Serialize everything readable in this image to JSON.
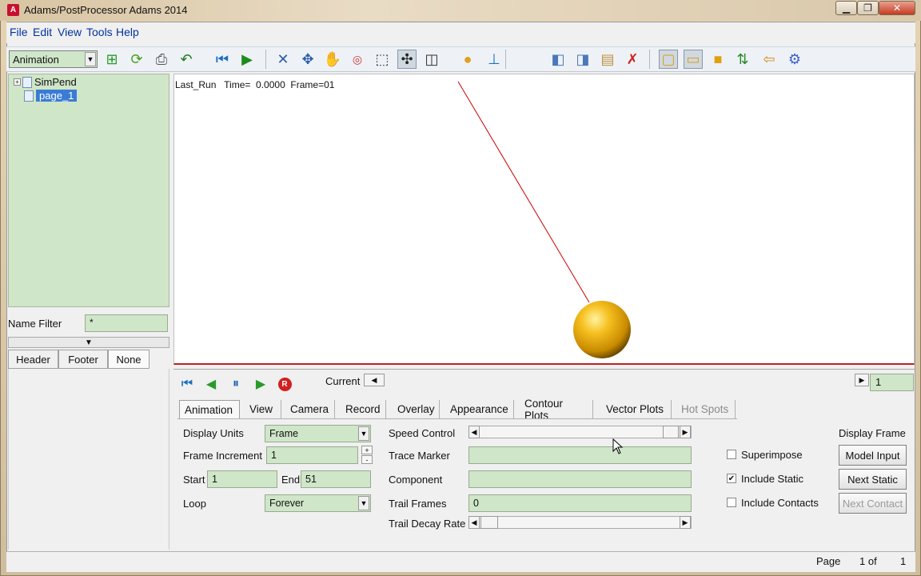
{
  "window": {
    "title": "Adams/PostProcessor Adams 2014",
    "logo_letter": "A"
  },
  "menu": [
    "File",
    "Edit",
    "View",
    "Tools",
    "Help"
  ],
  "toolbar": {
    "mode_select": "Animation",
    "icons": [
      "add-page-icon",
      "refresh-icon",
      "print-icon",
      "undo-icon",
      "rewind-icon",
      "play-icon",
      "select-icon",
      "translate-icon",
      "pan-hand-icon",
      "rotate-point-icon",
      "zoom-box-icon",
      "fit-icon",
      "wireframe-icon",
      "render-sphere-icon",
      "triad-icon",
      "prev-page-icon",
      "next-page-icon",
      "new-page-icon",
      "delete-page-icon",
      "layout-1-icon",
      "layout-2-icon",
      "layout-3-icon",
      "layout-4-icon",
      "layout-5-icon",
      "settings-gear-icon"
    ]
  },
  "tree": {
    "items": [
      {
        "label": "SimPend"
      },
      {
        "label": "page_1"
      }
    ]
  },
  "name_filter": {
    "label": "Name Filter",
    "value": "*"
  },
  "header_footer_tabs": [
    "Header",
    "Footer",
    "None"
  ],
  "viewport": {
    "info": "Last_Run   Time=  0.0000  Frame=01",
    "ball_color": "#f2b21a",
    "string_color": "#cc0000"
  },
  "anim_controls": {
    "current_label": "Current",
    "frame_value": "1",
    "record_glyph": "R"
  },
  "tabs": [
    "Animation",
    "View",
    "Camera",
    "Record",
    "Overlay",
    "Appearance",
    "Contour Plots",
    "Vector Plots",
    "Hot Spots"
  ],
  "form": {
    "display_units": {
      "label": "Display Units",
      "value": "Frame"
    },
    "frame_increment": {
      "label": "Frame Increment",
      "value": "1",
      "plus": "+",
      "minus": "-"
    },
    "start": {
      "label": "Start",
      "value": "1"
    },
    "end": {
      "label": "End",
      "value": "51"
    },
    "loop": {
      "label": "Loop",
      "value": "Forever"
    },
    "speed_control": {
      "label": "Speed Control"
    },
    "trace_marker": {
      "label": "Trace Marker",
      "value": ""
    },
    "component": {
      "label": "Component",
      "value": ""
    },
    "trail_frames": {
      "label": "Trail Frames",
      "value": "0"
    },
    "trail_decay_rate": {
      "label": "Trail Decay Rate"
    }
  },
  "right_options": {
    "display_frame_label": "Display Frame",
    "superimpose": {
      "label": "Superimpose",
      "checked": false
    },
    "include_static": {
      "label": "Include Static",
      "checked": true,
      "check_glyph": "✔"
    },
    "include_contacts": {
      "label": "Include Contacts",
      "checked": false
    },
    "model_input_button": "Model Input",
    "next_static_button": "Next Static",
    "next_contact_button": "Next Contact"
  },
  "status": {
    "page_label": "Page",
    "page_of": "1 of",
    "page_total": "1"
  }
}
